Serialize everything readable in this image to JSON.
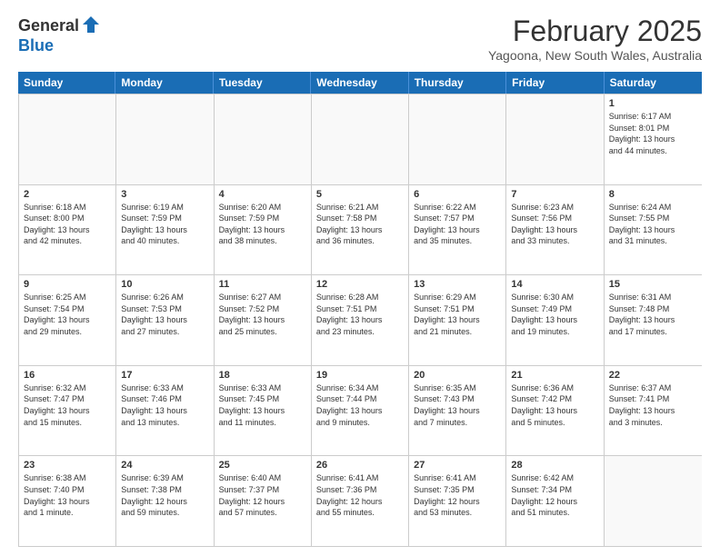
{
  "logo": {
    "general": "General",
    "blue": "Blue"
  },
  "header": {
    "month_year": "February 2025",
    "location": "Yagoona, New South Wales, Australia"
  },
  "weekdays": [
    "Sunday",
    "Monday",
    "Tuesday",
    "Wednesday",
    "Thursday",
    "Friday",
    "Saturday"
  ],
  "weeks": [
    [
      {
        "day": "",
        "info": ""
      },
      {
        "day": "",
        "info": ""
      },
      {
        "day": "",
        "info": ""
      },
      {
        "day": "",
        "info": ""
      },
      {
        "day": "",
        "info": ""
      },
      {
        "day": "",
        "info": ""
      },
      {
        "day": "1",
        "info": "Sunrise: 6:17 AM\nSunset: 8:01 PM\nDaylight: 13 hours\nand 44 minutes."
      }
    ],
    [
      {
        "day": "2",
        "info": "Sunrise: 6:18 AM\nSunset: 8:00 PM\nDaylight: 13 hours\nand 42 minutes."
      },
      {
        "day": "3",
        "info": "Sunrise: 6:19 AM\nSunset: 7:59 PM\nDaylight: 13 hours\nand 40 minutes."
      },
      {
        "day": "4",
        "info": "Sunrise: 6:20 AM\nSunset: 7:59 PM\nDaylight: 13 hours\nand 38 minutes."
      },
      {
        "day": "5",
        "info": "Sunrise: 6:21 AM\nSunset: 7:58 PM\nDaylight: 13 hours\nand 36 minutes."
      },
      {
        "day": "6",
        "info": "Sunrise: 6:22 AM\nSunset: 7:57 PM\nDaylight: 13 hours\nand 35 minutes."
      },
      {
        "day": "7",
        "info": "Sunrise: 6:23 AM\nSunset: 7:56 PM\nDaylight: 13 hours\nand 33 minutes."
      },
      {
        "day": "8",
        "info": "Sunrise: 6:24 AM\nSunset: 7:55 PM\nDaylight: 13 hours\nand 31 minutes."
      }
    ],
    [
      {
        "day": "9",
        "info": "Sunrise: 6:25 AM\nSunset: 7:54 PM\nDaylight: 13 hours\nand 29 minutes."
      },
      {
        "day": "10",
        "info": "Sunrise: 6:26 AM\nSunset: 7:53 PM\nDaylight: 13 hours\nand 27 minutes."
      },
      {
        "day": "11",
        "info": "Sunrise: 6:27 AM\nSunset: 7:52 PM\nDaylight: 13 hours\nand 25 minutes."
      },
      {
        "day": "12",
        "info": "Sunrise: 6:28 AM\nSunset: 7:51 PM\nDaylight: 13 hours\nand 23 minutes."
      },
      {
        "day": "13",
        "info": "Sunrise: 6:29 AM\nSunset: 7:51 PM\nDaylight: 13 hours\nand 21 minutes."
      },
      {
        "day": "14",
        "info": "Sunrise: 6:30 AM\nSunset: 7:49 PM\nDaylight: 13 hours\nand 19 minutes."
      },
      {
        "day": "15",
        "info": "Sunrise: 6:31 AM\nSunset: 7:48 PM\nDaylight: 13 hours\nand 17 minutes."
      }
    ],
    [
      {
        "day": "16",
        "info": "Sunrise: 6:32 AM\nSunset: 7:47 PM\nDaylight: 13 hours\nand 15 minutes."
      },
      {
        "day": "17",
        "info": "Sunrise: 6:33 AM\nSunset: 7:46 PM\nDaylight: 13 hours\nand 13 minutes."
      },
      {
        "day": "18",
        "info": "Sunrise: 6:33 AM\nSunset: 7:45 PM\nDaylight: 13 hours\nand 11 minutes."
      },
      {
        "day": "19",
        "info": "Sunrise: 6:34 AM\nSunset: 7:44 PM\nDaylight: 13 hours\nand 9 minutes."
      },
      {
        "day": "20",
        "info": "Sunrise: 6:35 AM\nSunset: 7:43 PM\nDaylight: 13 hours\nand 7 minutes."
      },
      {
        "day": "21",
        "info": "Sunrise: 6:36 AM\nSunset: 7:42 PM\nDaylight: 13 hours\nand 5 minutes."
      },
      {
        "day": "22",
        "info": "Sunrise: 6:37 AM\nSunset: 7:41 PM\nDaylight: 13 hours\nand 3 minutes."
      }
    ],
    [
      {
        "day": "23",
        "info": "Sunrise: 6:38 AM\nSunset: 7:40 PM\nDaylight: 13 hours\nand 1 minute."
      },
      {
        "day": "24",
        "info": "Sunrise: 6:39 AM\nSunset: 7:38 PM\nDaylight: 12 hours\nand 59 minutes."
      },
      {
        "day": "25",
        "info": "Sunrise: 6:40 AM\nSunset: 7:37 PM\nDaylight: 12 hours\nand 57 minutes."
      },
      {
        "day": "26",
        "info": "Sunrise: 6:41 AM\nSunset: 7:36 PM\nDaylight: 12 hours\nand 55 minutes."
      },
      {
        "day": "27",
        "info": "Sunrise: 6:41 AM\nSunset: 7:35 PM\nDaylight: 12 hours\nand 53 minutes."
      },
      {
        "day": "28",
        "info": "Sunrise: 6:42 AM\nSunset: 7:34 PM\nDaylight: 12 hours\nand 51 minutes."
      },
      {
        "day": "",
        "info": ""
      }
    ]
  ]
}
